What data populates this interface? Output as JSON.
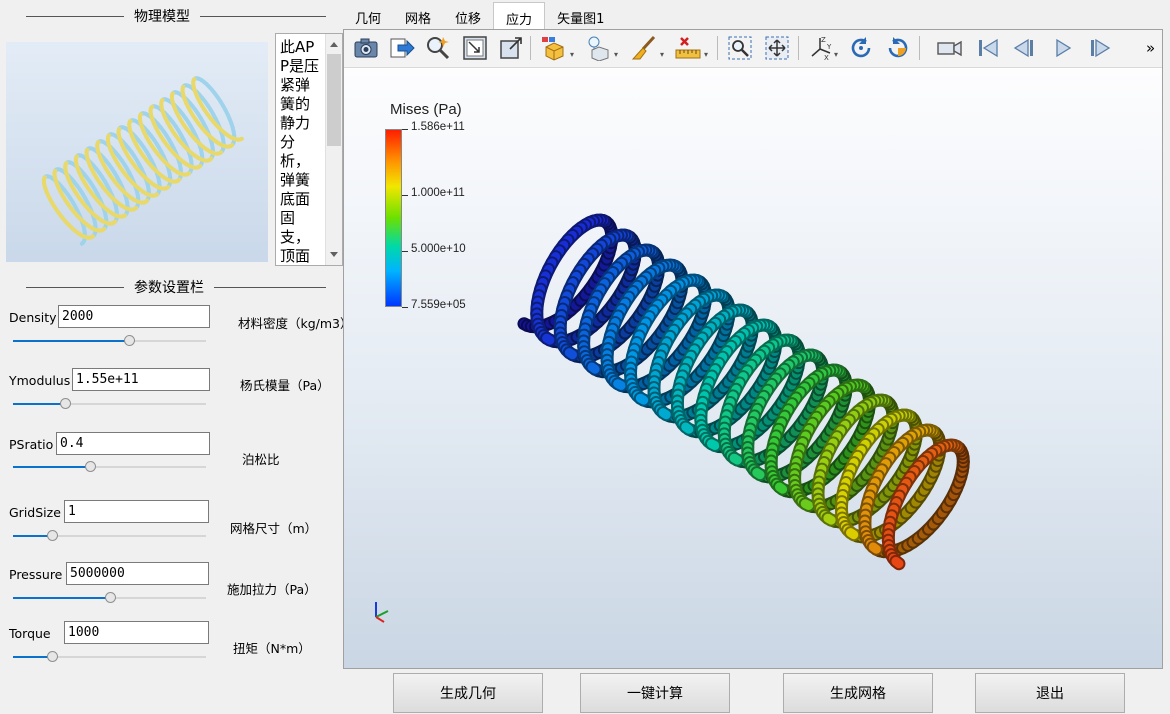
{
  "left": {
    "model_title": "物理模型",
    "description": "此APP是压紧弹簧的静力分析，弹簧底面固支，顶面施加拉力和扭矩",
    "params_title": "参数设置栏",
    "params": [
      {
        "label": "Density",
        "value": "2000",
        "unit": "材料密度（kg/m3）",
        "slider_frac": 0.6
      },
      {
        "label": "Ymodulus",
        "value": "1.55e+11",
        "unit": "杨氏模量（Pa）",
        "slider_frac": 0.27
      },
      {
        "label": "PSratio",
        "value": "0.4",
        "unit": "泊松比",
        "slider_frac": 0.4
      },
      {
        "label": "GridSize",
        "value": "1",
        "unit": "网格尺寸（m）",
        "slider_frac": 0.2
      },
      {
        "label": "Pressure",
        "value": "5000000",
        "unit": "施加拉力（Pa）",
        "slider_frac": 0.5
      },
      {
        "label": "Torque",
        "value": "1000",
        "unit": "扭矩（N*m）",
        "slider_frac": 0.2
      }
    ]
  },
  "tabs": [
    "几何",
    "网格",
    "位移",
    "应力",
    "矢量图1"
  ],
  "active_tab": "应力",
  "toolbar": {
    "icons": [
      "camera-icon",
      "export-arrow-icon",
      "zoom-select-icon",
      "zoom-box-icon",
      "zoom-extents-icon",
      "views-icon",
      "lighting-icon",
      "clean-brush-icon",
      "ruler-icon",
      "zoom-window-icon",
      "fit-all-icon",
      "axis-orientation-icon",
      "rotate-left-icon",
      "rotate-right-icon",
      "camera-record-icon",
      "skip-first-icon",
      "step-back-icon",
      "play-icon",
      "step-forward-icon"
    ],
    "more": "»"
  },
  "colorbar": {
    "title": "Mises (Pa)",
    "labels": [
      "1.586e+11",
      "1.000e+11",
      "5.000e+10",
      "7.559e+05"
    ]
  },
  "buttons": [
    "生成几何",
    "一键计算",
    "生成网格",
    "退出"
  ],
  "colors": {
    "accent": "#0a72cc",
    "spring_start": "#1a1ad6",
    "spring_end": "#e0401a"
  }
}
